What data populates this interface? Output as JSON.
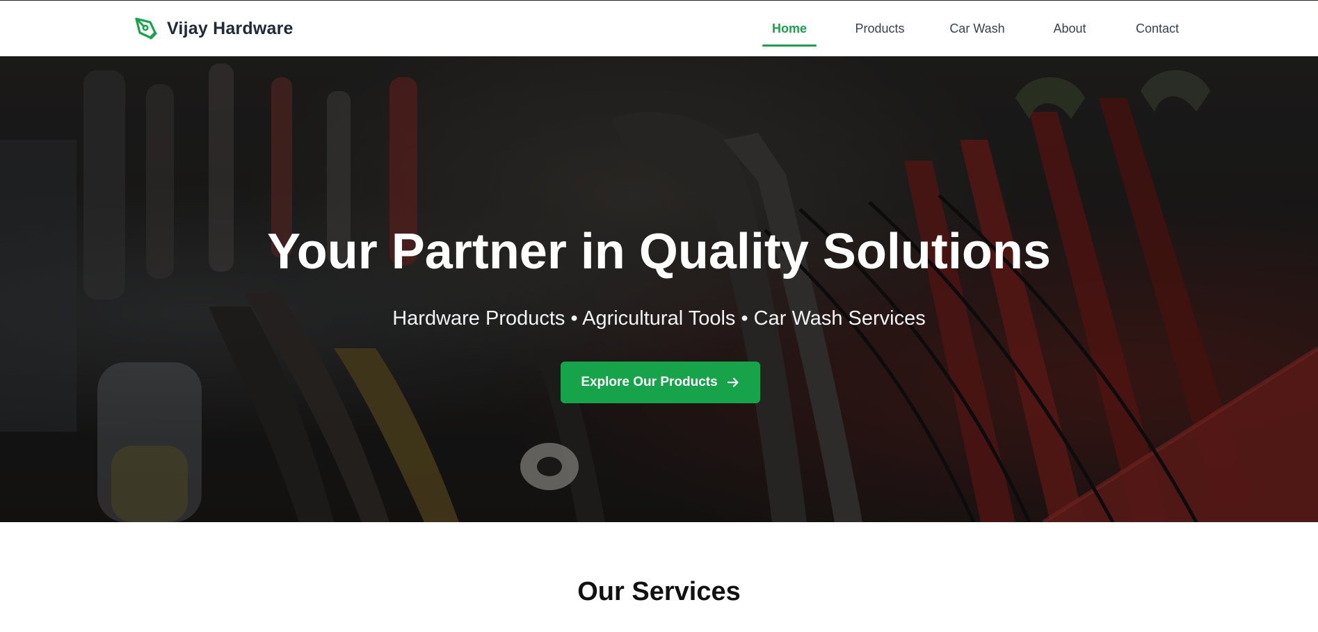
{
  "brand": {
    "name": "Vijay Hardware",
    "icon": "pen-nib-icon",
    "accent_color": "#16a34a"
  },
  "nav": {
    "items": [
      {
        "label": "Home",
        "active": true
      },
      {
        "label": "Products",
        "active": false
      },
      {
        "label": "Car Wash",
        "active": false
      },
      {
        "label": "About",
        "active": false
      },
      {
        "label": "Contact",
        "active": false
      }
    ]
  },
  "hero": {
    "title": "Your Partner in Quality Solutions",
    "subtitle": "Hardware Products • Agricultural Tools • Car Wash Services",
    "cta_label": "Explore Our Products",
    "cta_icon": "arrow-right-icon",
    "background": "dark photo of hand tools (pliers, wrenches) in a rack"
  },
  "services": {
    "title": "Our Services"
  }
}
